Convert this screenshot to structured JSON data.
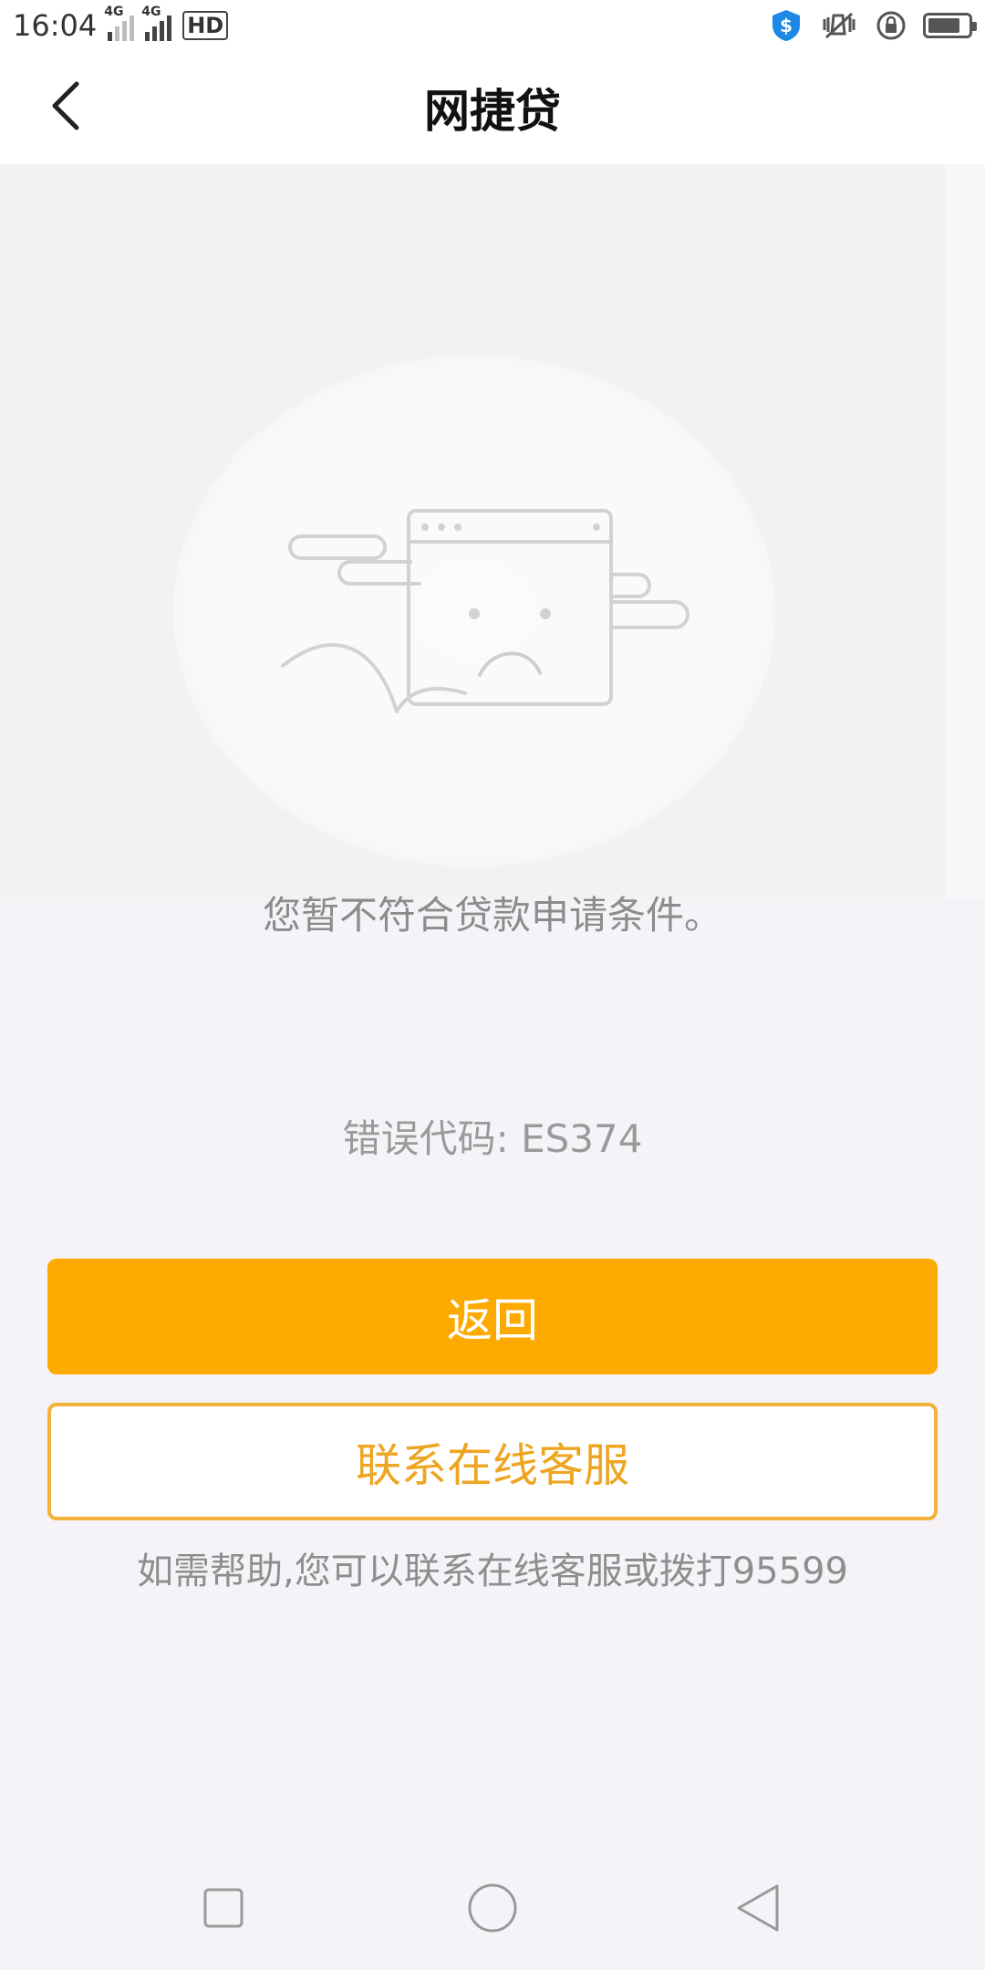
{
  "status_bar": {
    "time": "16:04",
    "network_1": "4G",
    "network_2": "4G",
    "hd_label": "HD"
  },
  "header": {
    "title": "网捷贷"
  },
  "content": {
    "message": "您暂不符合贷款申请条件。",
    "error_code": "错误代码: ES374"
  },
  "buttons": {
    "return_label": "返回",
    "contact_label": "联系在线客服"
  },
  "help_text": "如需帮助,您可以联系在线客服或拨打95599",
  "colors": {
    "primary": "#fdaa00",
    "outline": "#f3b23a",
    "outline_text": "#eea521"
  }
}
